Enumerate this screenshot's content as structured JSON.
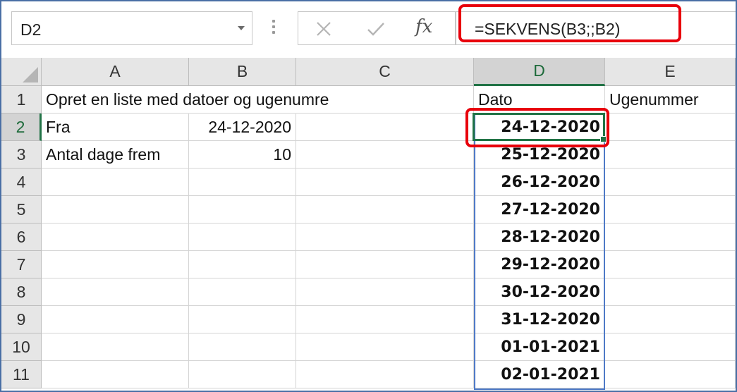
{
  "formula_bar": {
    "name_box": "D2",
    "cancel_icon": "x-icon",
    "enter_icon": "checkmark-icon",
    "function_icon": "fx-icon",
    "fx_label": "fx",
    "formula": "=SEKVENS(B3;;B2)"
  },
  "columns": [
    "A",
    "B",
    "C",
    "D",
    "E"
  ],
  "rows": [
    "1",
    "2",
    "3",
    "4",
    "5",
    "6",
    "7",
    "8",
    "9",
    "10",
    "11"
  ],
  "cells": {
    "A1": "Opret en liste med datoer og ugenumre",
    "D1": "Dato",
    "E1": "Ugenummer",
    "A2": "Fra",
    "B2": "24-12-2020",
    "A3": "Antal dage frem",
    "B3": "10"
  },
  "dates": [
    "24-12-2020",
    "25-12-2020",
    "26-12-2020",
    "27-12-2020",
    "28-12-2020",
    "29-12-2020",
    "30-12-2020",
    "31-12-2020",
    "01-01-2021",
    "02-01-2021"
  ],
  "selection": {
    "active_cell": "D2"
  },
  "colors": {
    "highlight": "#e8000b",
    "excel_green": "#217346",
    "spill_border": "#4f7ac7"
  }
}
